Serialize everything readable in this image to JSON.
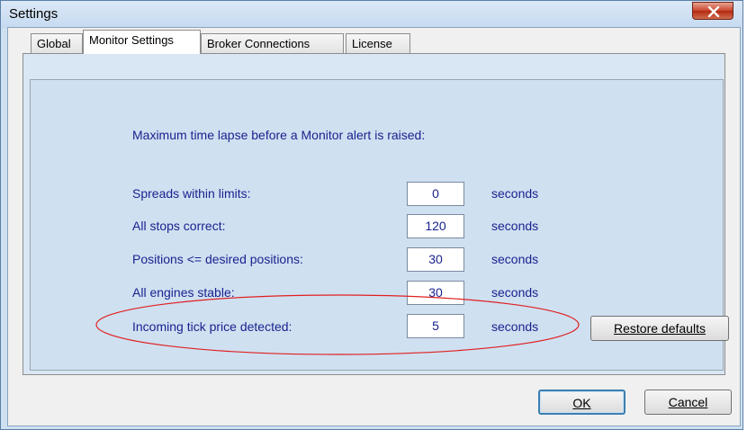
{
  "window": {
    "title": "Settings",
    "close_label": "X"
  },
  "tabs": [
    {
      "label": "Global",
      "active": false
    },
    {
      "label": "Monitor Settings",
      "active": true
    },
    {
      "label": "Broker Connections",
      "active": false
    },
    {
      "label": "License",
      "active": false
    }
  ],
  "monitor": {
    "heading": "Maximum time lapse before a Monitor alert is raised:",
    "rows": [
      {
        "label": "Spreads within limits:",
        "value": "0",
        "unit": "seconds"
      },
      {
        "label": "All stops correct:",
        "value": "120",
        "unit": "seconds"
      },
      {
        "label": "Positions <= desired positions:",
        "value": "30",
        "unit": "seconds"
      },
      {
        "label": "All engines stable:",
        "value": "30",
        "unit": "seconds"
      },
      {
        "label": "Incoming tick price detected:",
        "value": "5",
        "unit": "seconds"
      }
    ],
    "restore_label": "Restore defaults"
  },
  "footer": {
    "ok_label": "OK",
    "cancel_label": "Cancel"
  },
  "colors": {
    "label_text": "#1a238e",
    "annotation_ellipse": "#e02020"
  }
}
